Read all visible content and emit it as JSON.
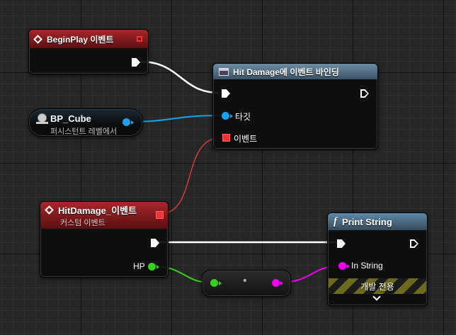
{
  "begin_play": {
    "title": "BeginPlay 이벤트"
  },
  "bind_node": {
    "title": "Hit Damage에 이벤트 바인딩",
    "target_label": "타깃",
    "event_label": "이벤트"
  },
  "bp_cube": {
    "name": "BP_Cube",
    "subtitle": "퍼시스턴트 레벨에서"
  },
  "hit_event": {
    "title": "HitDamage_이벤트",
    "subtitle": "커스텀 이벤트",
    "hp_label": "HP"
  },
  "print_node": {
    "title": "Print String",
    "in_string_label": "In String",
    "dev_only_label": "개발 전용"
  },
  "convert_node": {
    "dot": "•"
  },
  "colors": {
    "exec": "#ffffff",
    "object": "#16a2f0",
    "delegate": "#e03232",
    "float": "#33d11a",
    "string": "#f000f0"
  }
}
